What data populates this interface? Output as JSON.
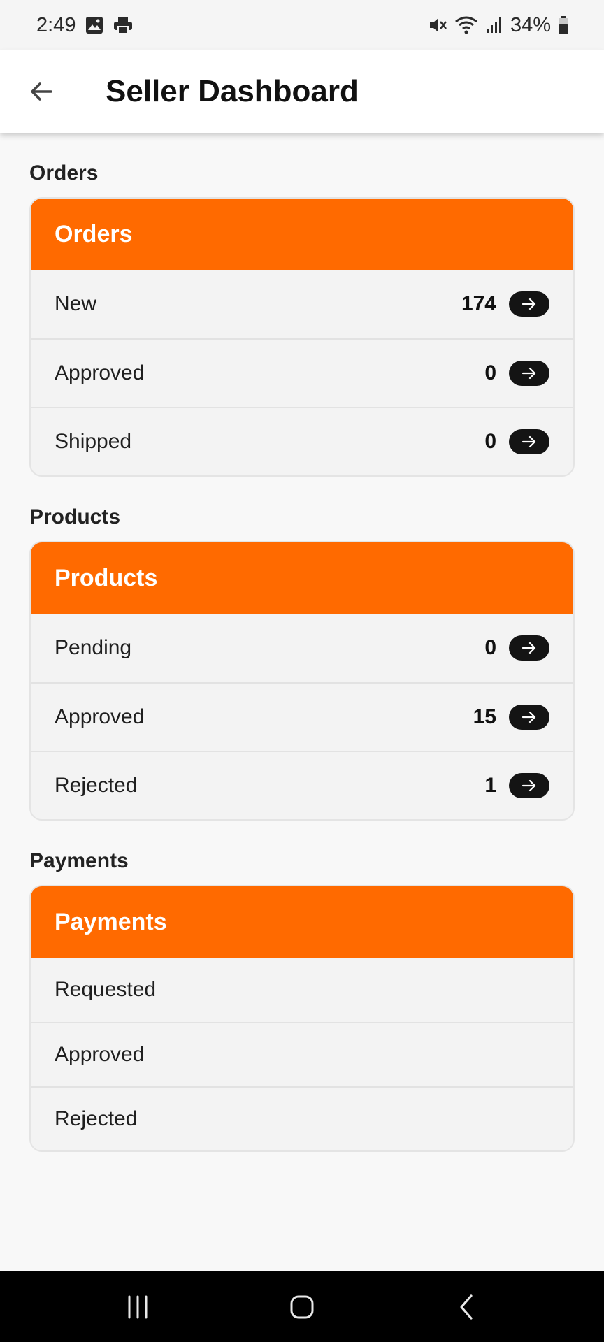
{
  "status_bar": {
    "time": "2:49",
    "battery": "34%",
    "icons": [
      "image-icon",
      "print-icon",
      "mute-icon",
      "wifi-icon",
      "signal-icon",
      "battery-icon"
    ]
  },
  "app_bar": {
    "title": "Seller Dashboard",
    "back_icon": "arrow-left-icon"
  },
  "sections": {
    "orders": {
      "label": "Orders",
      "header": "Orders",
      "rows": [
        {
          "label": "New",
          "count": "174"
        },
        {
          "label": "Approved",
          "count": "0"
        },
        {
          "label": "Shipped",
          "count": "0"
        }
      ]
    },
    "products": {
      "label": "Products",
      "header": "Products",
      "rows": [
        {
          "label": "Pending",
          "count": "0"
        },
        {
          "label": "Approved",
          "count": "15"
        },
        {
          "label": "Rejected",
          "count": "1"
        }
      ]
    },
    "payments": {
      "label": "Payments",
      "header": "Payments",
      "rows": [
        {
          "label": "Requested"
        },
        {
          "label": "Approved"
        },
        {
          "label": "Rejected"
        }
      ]
    }
  },
  "colors": {
    "accent": "#ff6a00",
    "pill": "#141414",
    "background": "#f8f8f8"
  },
  "nav_bar": {
    "icons": [
      "recent-apps-icon",
      "home-icon",
      "back-nav-icon"
    ]
  }
}
